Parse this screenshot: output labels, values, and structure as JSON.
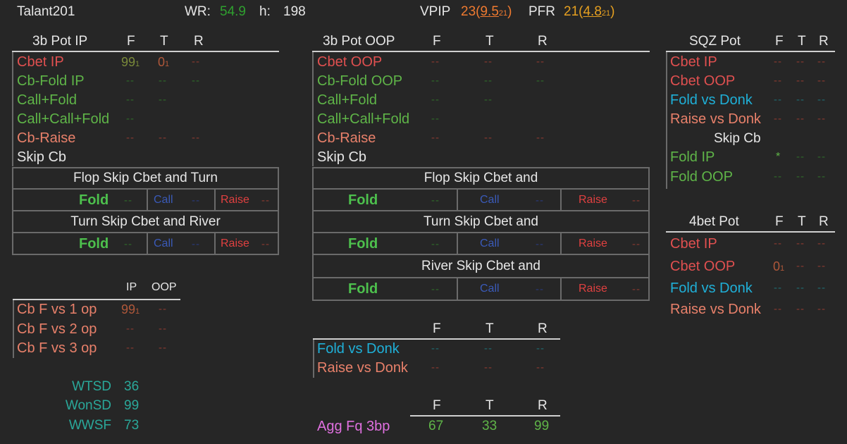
{
  "header": {
    "player": "Talant201",
    "wr_label": "WR:",
    "wr_value": "54.9",
    "h_label": "h:",
    "h_value": "198",
    "vpip_label": "VPIP",
    "vpip_value": "23",
    "vpip_paren_open": "(",
    "vpip_sub_value": "9.5",
    "vpip_sub_count": "21",
    "vpip_paren_close": ")",
    "pfr_label": "PFR",
    "pfr_value": "21",
    "pfr_paren_open": "(",
    "pfr_sub_value": "4.8",
    "pfr_sub_count": "21",
    "pfr_paren_close": ")"
  },
  "ip_panel": {
    "title": "3b  Pot IP",
    "col_f": "F",
    "col_t": "T",
    "col_r": "R",
    "rows": [
      {
        "label": "Cbet IP",
        "f": "99",
        "f_sub": "1",
        "t": "0",
        "t_sub": "1",
        "r": "--"
      },
      {
        "label": "Cb-Fold IP",
        "f": "--",
        "t": "--",
        "r": "--"
      },
      {
        "label": "Call+Fold",
        "f": "--",
        "t": "--"
      },
      {
        "label": "Call+Call+Fold",
        "f": "--"
      },
      {
        "label": "Cb-Raise",
        "f": "--",
        "t": "--",
        "r": "--"
      },
      {
        "label": "Skip Cb"
      }
    ],
    "flop_title": "Flop Skip Cbet and Turn",
    "turn_title": "Turn Skip Cbet and River",
    "fold": "Fold",
    "call": "Call",
    "raise": "Raise",
    "dash": "--"
  },
  "oop_panel": {
    "title": "3b  Pot OOP",
    "col_f": "F",
    "col_t": "T",
    "col_r": "R",
    "rows": [
      {
        "label": "Cbet OOP",
        "f": "--",
        "t": "--",
        "r": "--"
      },
      {
        "label": "Cb-Fold OOP",
        "f": "--",
        "t": "--",
        "r": "--"
      },
      {
        "label": "Call+Fold",
        "f": "--",
        "t": "--"
      },
      {
        "label": "Call+Call+Fold",
        "f": "--"
      },
      {
        "label": "Cb-Raise",
        "f": "--",
        "t": "--",
        "r": "--"
      },
      {
        "label": "Skip Cb"
      }
    ],
    "flop_title": "Flop Skip Cbet and",
    "turn_title": "Turn Skip Cbet and",
    "river_title": "River Skip Cbet and",
    "fold": "Fold",
    "call": "Call",
    "raise": "Raise",
    "dash": "--"
  },
  "cbf_panel": {
    "col_ip": "IP",
    "col_oop": "OOP",
    "rows": [
      {
        "label": "Cb F vs 1 op",
        "ip": "99",
        "ip_sub": "1",
        "oop": "--"
      },
      {
        "label": "Cb F vs 2 op",
        "ip": "--",
        "oop": "--"
      },
      {
        "label": "Cb F vs 3 op",
        "ip": "--",
        "oop": "--"
      }
    ]
  },
  "showdown": [
    {
      "label": "WTSD",
      "value": "36"
    },
    {
      "label": "WonSD",
      "value": "99"
    },
    {
      "label": "WWSF",
      "value": "73"
    }
  ],
  "donk_panel": {
    "col_f": "F",
    "col_t": "T",
    "col_r": "R",
    "rows": [
      {
        "label": "Fold vs Donk",
        "f": "--",
        "t": "--",
        "r": "--"
      },
      {
        "label": "Raise vs Donk",
        "f": "--",
        "t": "--",
        "r": "--"
      }
    ]
  },
  "agg_panel": {
    "col_f": "F",
    "col_t": "T",
    "col_r": "R",
    "label": "Agg Fq 3bp",
    "f": "67",
    "t": "33",
    "r": "99"
  },
  "sqz_panel": {
    "title": "SQZ Pot",
    "col_f": "F",
    "col_t": "T",
    "col_r": "R",
    "rows": [
      {
        "label": "Cbet IP",
        "f": "--",
        "t": "--",
        "r": "--"
      },
      {
        "label": "Cbet OOP",
        "f": "--",
        "t": "--",
        "r": "--"
      },
      {
        "label": "Fold vs Donk",
        "f": "--",
        "t": "--",
        "r": "--"
      },
      {
        "label": "Raise vs Donk",
        "f": "--",
        "t": "--",
        "r": "--"
      }
    ],
    "skip_title": "Skip Cb",
    "skip_rows": [
      {
        "label": "Fold IP",
        "f": "*",
        "t": "--",
        "r": "--"
      },
      {
        "label": "Fold OOP",
        "f": "--",
        "t": "--",
        "r": "--"
      }
    ]
  },
  "fourbet_panel": {
    "title": "4bet Pot",
    "col_f": "F",
    "col_t": "T",
    "col_r": "R",
    "rows": [
      {
        "label": "Cbet IP",
        "f": "--",
        "t": "--",
        "r": "--"
      },
      {
        "label": "Cbet OOP",
        "f": "0",
        "f_sub": "1",
        "t": "--",
        "r": "--"
      },
      {
        "label": "Fold vs Donk",
        "f": "--",
        "t": "--",
        "r": "--"
      },
      {
        "label": "Raise vs Donk",
        "f": "--",
        "t": "--",
        "r": "--"
      }
    ]
  }
}
